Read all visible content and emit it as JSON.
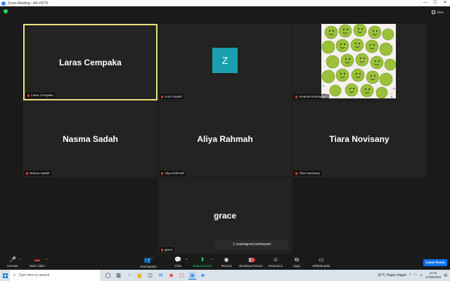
{
  "window": {
    "title": "Zoom Meeting - A4-VIF70",
    "minimize": "—",
    "maximize": "☐",
    "close": "✕"
  },
  "view_button": {
    "label": "View"
  },
  "tiles": [
    {
      "display_name": "Laras Cempaka",
      "label": "Laras Cempaka",
      "active": true
    },
    {
      "display_name": "",
      "label": "zoom baa04",
      "avatar_letter": "Z"
    },
    {
      "display_name": "",
      "label": "Amanda Rahmadani",
      "has_video": true
    },
    {
      "display_name": "Nasma Sadah",
      "label": "Nasma Sadah"
    },
    {
      "display_name": "Aliya Rahmah",
      "label": "Aliya Rahmah"
    },
    {
      "display_name": "Tiara Novisany",
      "label": "Tiara Novisany"
    },
    {
      "display_name": "grace",
      "label": "grace"
    }
  ],
  "unassigned": "1 unassigned participant",
  "toolbar": {
    "unmute": "Unmute",
    "start_video": "Start Video",
    "participants": "Participants",
    "participants_count": "7",
    "chat": "Chat",
    "share_screen": "Share Screen",
    "record": "Record",
    "breakout_rooms": "Breakout Rooms",
    "breakout_badge": "1",
    "reactions": "Reactions",
    "apps": "Apps",
    "whiteboards": "Whiteboards",
    "leave_room": "Leave Room"
  },
  "taskbar": {
    "search_placeholder": "Type here to search",
    "weather": "32°C  Hujan ringan",
    "time": "13:41",
    "date": "17/05/2022"
  },
  "colors": {
    "active_border": "#e8e37c",
    "avatar_bg": "#1a9fb1",
    "muted_red": "#e0332c",
    "share_green": "#23d959",
    "leave_blue": "#0e72ed"
  }
}
